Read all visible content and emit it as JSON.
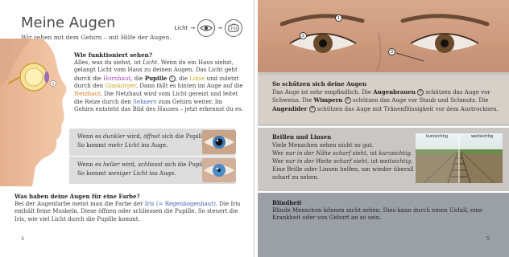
{
  "left_page": {
    "title": "Meine Augen",
    "subtitle": "Wir sehen mit dem Gehirn – mit Hilfe der Augen.",
    "diagram": {
      "label": "Licht",
      "arrow": "→"
    },
    "how_heading": "Wie funktioniert sehen?",
    "how_text": {
      "p1": "Alles, was du siehst, ist ",
      "licht": "Licht",
      "p2": ". Wenn du ein Haus siehst, gelangt Licht vom Haus zu deinen Augen. Das Licht geht durch die ",
      "hornhaut": "Hornhaut",
      "p3": ", die ",
      "pupille": "Pupille",
      "pupille_marker": "1",
      "p4": ", die ",
      "linse": "Linse",
      "p5": " und zuletzt durch den ",
      "glaskoerper": "Glaskörper",
      "p6": ". Dann fällt es hinten im Auge auf die ",
      "netzhaut": "Netzhaut",
      "p7": ". Die Netzhaut wird vom Licht gereizt und leitet die Reize durch den ",
      "sehnerv": "Sehnerv",
      "p8": " zum Gehirn weiter. Im Gehirn entsteht das Bild des Hauses – jetzt erkennst du es."
    },
    "box1": {
      "l1a": "Wenn es ",
      "l1b": "dunkler",
      "l1c": " wird, ",
      "l1d": "öffnet",
      "l1e": " sich die Pupille.",
      "l2a": "So kommt ",
      "l2b": "mehr Licht",
      "l2c": " ins Auge."
    },
    "box2": {
      "l1a": "Wenn es ",
      "l1b": "heller",
      "l1c": " wird, ",
      "l1d": "schliesst",
      "l1e": " sich die Pupille.",
      "l2a": "So kommt ",
      "l2b": "weniger Licht",
      "l2c": " ins Auge."
    },
    "iris_heading": "Was haben deine Augen für eine Farbe?",
    "iris_text": {
      "p1": "Bei der Augenfarbe meint man die Farbe der ",
      "iris": "Iris (= Regenbogenhaut)",
      "p2": ". Die Iris enthält feine Muskeln. Diese öffnen oder schliessen die Pupille. So steuert die Iris, wie viel Licht durch die Pupille kommt."
    },
    "page_number": "4"
  },
  "right_page": {
    "face_markers": [
      "1",
      "2",
      "3"
    ],
    "protect_heading": "So schützen sich deine Augen",
    "protect_text": {
      "p1": "Das Auge ist sehr empfindlich. Die ",
      "brauen": "Augenbrauen",
      "m1": "1",
      "p2": " schützen das Auge vor Schweiss. Die ",
      "wimpern": "Wimpern",
      "m2": "2",
      "p3": " schützen das Auge vor Staub und Schmutz. Die ",
      "lider": "Augenlider",
      "m3": "3",
      "p4": " schützen das Auge mit Tränenflüssigkeit vor dem Austrocknen."
    },
    "glasses_heading": "Brillen und Linsen",
    "glasses_text": {
      "l1": "Viele Menschen sehen nicht so gut.",
      "l2a": "Wer ",
      "l2b": "nur in der Nähe scharf sieht",
      "l2c": ", ist ",
      "l2d": "kurzsichtig",
      "l2e": ".",
      "l3a": "Wer ",
      "l3b": "nur in der Weite scharf sieht",
      "l3c": ", ist ",
      "l3d": "weitsichtig",
      "l3e": ".",
      "l4": "Eine Brille oder Linsen helfen, um wieder überall scharf zu sehen."
    },
    "tracks_labels": {
      "left": "kurzsichtig",
      "right": "weitsichtig"
    },
    "blind_heading": "Blindheit",
    "blind_text": "Blinde Menschen können nicht sehen. Dies kann durch einen Unfall, eine Krankheit oder von Geburt an so sein.",
    "page_number": "5"
  }
}
